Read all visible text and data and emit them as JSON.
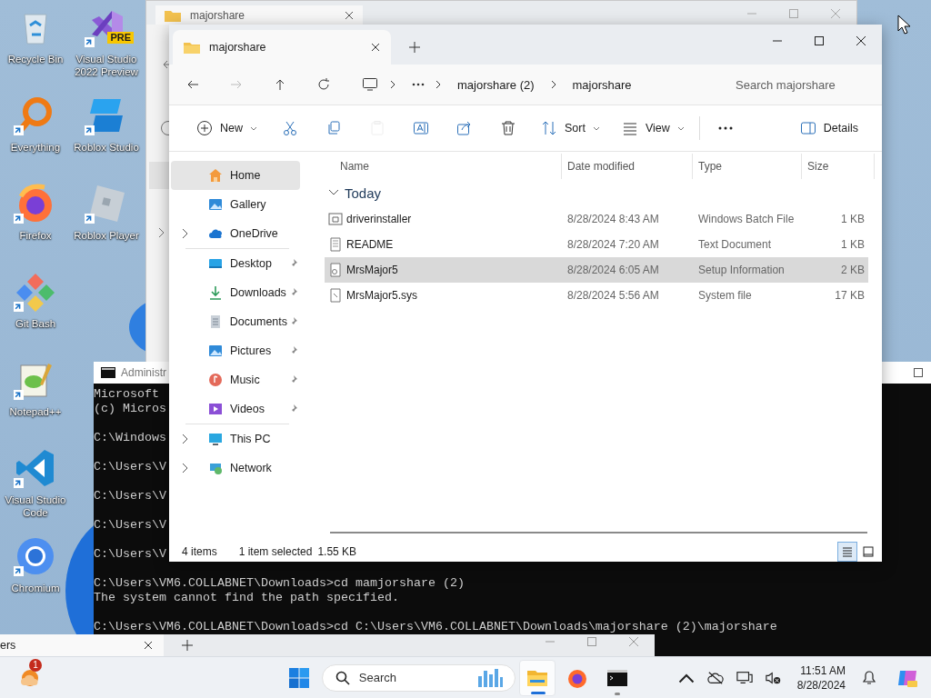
{
  "desktop_columns": [
    [
      {
        "label": "Recycle Bin",
        "kind": "recycle",
        "shortcut": false
      },
      {
        "label": "Everything",
        "kind": "everything",
        "shortcut": true
      },
      {
        "label": "Firefox",
        "kind": "firefox",
        "shortcut": true
      },
      {
        "label": "Git Bash",
        "kind": "gitbash",
        "shortcut": true
      },
      {
        "label": "Notepad++",
        "kind": "notepadpp",
        "shortcut": true
      },
      {
        "label": "Visual Studio Code",
        "kind": "vscode",
        "shortcut": true
      },
      {
        "label": "Chromium",
        "kind": "chromium",
        "shortcut": true
      }
    ],
    [
      {
        "label": "Visual Studio 2022 Preview",
        "kind": "vs",
        "shortcut": true,
        "badge": "PRE"
      },
      {
        "label": "Roblox Studio",
        "kind": "robloxstudio",
        "shortcut": true
      },
      {
        "label": "Roblox Player",
        "kind": "robloxplayer",
        "shortcut": true
      }
    ]
  ],
  "back_window": {
    "tab_title": "majorshare"
  },
  "console": {
    "title": "Administr",
    "blocks": [
      [
        "Microsoft",
        "(c) Micros"
      ],
      [
        "C:\\Windows"
      ],
      [
        "C:\\Users\\V"
      ],
      [
        "C:\\Users\\V"
      ],
      [
        "C:\\Users\\V"
      ],
      [
        "C:\\Users\\V"
      ],
      [
        "C:\\Users\\VM6.COLLABNET\\Downloads>cd mamjorshare (2)",
        "The system cannot find the path specified."
      ],
      [
        "C:\\Users\\VM6.COLLABNET\\Downloads>cd C:\\Users\\VM6.COLLABNET\\Downloads\\majorshare (2)\\majorshare"
      ]
    ]
  },
  "explorer": {
    "tab_title": "majorshare",
    "breadcrumb": [
      "majorshare (2)",
      "majorshare"
    ],
    "search_placeholder": "Search majorshare",
    "toolbar": [
      {
        "kind": "new",
        "label": "New",
        "menu": true,
        "disabled": false
      },
      {
        "kind": "cut",
        "disabled": false
      },
      {
        "kind": "copy",
        "disabled": false
      },
      {
        "kind": "paste",
        "disabled": true
      },
      {
        "kind": "rename",
        "disabled": false
      },
      {
        "kind": "share",
        "disabled": false
      },
      {
        "kind": "delete",
        "disabled": false
      },
      {
        "kind": "sort",
        "label": "Sort",
        "menu": true,
        "disabled": false
      },
      {
        "kind": "view",
        "label": "View",
        "menu": true,
        "disabled": false
      },
      {
        "kind": "more",
        "disabled": false
      },
      {
        "kind": "details",
        "label": "Details",
        "menu": false,
        "disabled": false
      }
    ],
    "nav_sections": [
      [
        {
          "label": "Home",
          "kind": "home",
          "selected": true
        },
        {
          "label": "Gallery",
          "kind": "gallery",
          "selected": false
        },
        {
          "label": "OneDrive",
          "kind": "onedrive",
          "selected": false,
          "expanded": false
        }
      ],
      [
        {
          "label": "Desktop",
          "kind": "desktop",
          "selected": false,
          "pinned": true
        },
        {
          "label": "Downloads",
          "kind": "downloads",
          "selected": false,
          "pinned": true
        },
        {
          "label": "Documents",
          "kind": "documents",
          "selected": false,
          "pinned": true
        },
        {
          "label": "Pictures",
          "kind": "pictures",
          "selected": false,
          "pinned": true
        },
        {
          "label": "Music",
          "kind": "music",
          "selected": false,
          "pinned": true
        },
        {
          "label": "Videos",
          "kind": "videos",
          "selected": false,
          "pinned": true
        }
      ],
      [
        {
          "label": "This PC",
          "kind": "thispc",
          "selected": false,
          "expanded": false
        },
        {
          "label": "Network",
          "kind": "network",
          "selected": false,
          "expanded": false
        }
      ]
    ],
    "columns": [
      "Name",
      "Date modified",
      "Type",
      "Size"
    ],
    "group": {
      "label": "Today",
      "expanded": true
    },
    "files": [
      {
        "name": "driverinstaller",
        "date": "8/28/2024 8:43 AM",
        "type": "Windows Batch File",
        "size": "1 KB",
        "kind": "batch",
        "selected": false
      },
      {
        "name": "README",
        "date": "8/28/2024 7:20 AM",
        "type": "Text Document",
        "size": "1 KB",
        "kind": "text",
        "selected": false
      },
      {
        "name": "MrsMajor5",
        "date": "8/28/2024 6:05 AM",
        "type": "Setup Information",
        "size": "2 KB",
        "kind": "setup",
        "selected": true
      },
      {
        "name": "MrsMajor5.sys",
        "date": "8/28/2024 5:56 AM",
        "type": "System file",
        "size": "17 KB",
        "kind": "system",
        "selected": false
      }
    ],
    "status": {
      "count": "4 items",
      "selection": "1 item selected",
      "size": "1.55 KB"
    },
    "views": [
      {
        "kind": "details",
        "selected": true
      },
      {
        "kind": "tiles",
        "selected": false
      }
    ]
  },
  "bottom_window": {
    "tab_title": "ers"
  },
  "taskbar": {
    "weather_badge": "1",
    "search_placeholder": "Search",
    "apps": [
      {
        "kind": "explorer",
        "active": true,
        "running": true
      },
      {
        "kind": "firefox",
        "active": false,
        "running": false
      },
      {
        "kind": "terminal",
        "active": false,
        "running": true
      }
    ],
    "time": "11:51 AM",
    "date": "8/28/2024"
  }
}
